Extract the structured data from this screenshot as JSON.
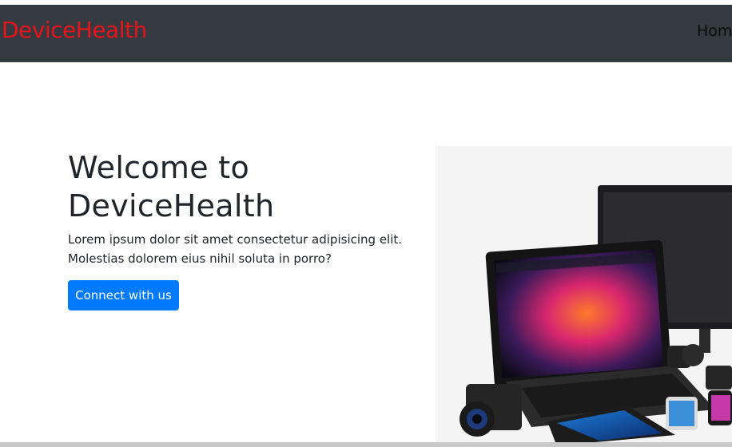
{
  "navbar": {
    "brand": "DeviceHealth",
    "links": [
      {
        "label": "Hom"
      }
    ]
  },
  "hero": {
    "title": "Welcome to DeviceHealth",
    "text": "Lorem ipsum dolor sit amet consectetur adipisicing elit. Molestias dolorem eius nihil soluta in porro?",
    "button_label": "Connect with us",
    "image_icon": "devices-photo"
  },
  "colors": {
    "navbar_bg": "#343a40",
    "brand": "#e8141b",
    "button": "#007bff"
  }
}
